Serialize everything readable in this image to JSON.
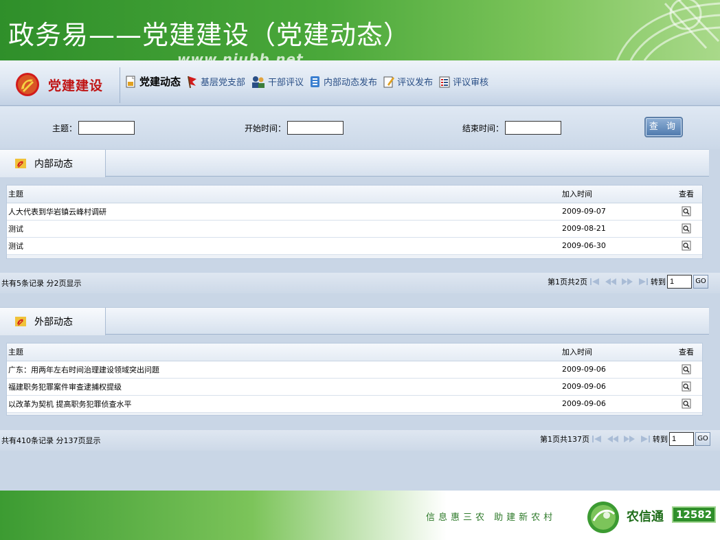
{
  "slide": {
    "title": "政务易——党建建设（党建动态）",
    "watermark": "www.niubb.net"
  },
  "brand": {
    "label": "党建建设",
    "icon": "party-emblem-icon"
  },
  "nav": [
    {
      "label": "党建动态",
      "icon": "document-icon",
      "active": true
    },
    {
      "label": "基层党支部",
      "icon": "flag-icon",
      "active": false
    },
    {
      "label": "干部评议",
      "icon": "people-icon",
      "active": false
    },
    {
      "label": "内部动态发布",
      "icon": "publish-icon",
      "active": false
    },
    {
      "label": "评议发布",
      "icon": "edit-icon",
      "active": false
    },
    {
      "label": "评议审核",
      "icon": "review-icon",
      "active": false
    }
  ],
  "search": {
    "subject_label": "主题：",
    "start_label": "开始时间：",
    "end_label": "结束时间：",
    "query_button": "查 询"
  },
  "sections": {
    "internal": {
      "title": "内部动态",
      "headers": {
        "subject": "主题",
        "date": "加入时间",
        "view": "查看"
      },
      "rows": [
        {
          "subject": "人大代表到华岩镇云峰村调研",
          "date": "2009-09-07"
        },
        {
          "subject": "测试",
          "date": "2009-08-21"
        },
        {
          "subject": "测试",
          "date": "2009-06-30"
        }
      ],
      "summary": "共有5条记录 分2页显示",
      "page_info": "第1页共2页",
      "goto_label": "转到",
      "goto_value": "1",
      "go_button": "GO"
    },
    "external": {
      "title": "外部动态",
      "headers": {
        "subject": "主题",
        "date": "加入时间",
        "view": "查看"
      },
      "rows": [
        {
          "subject": "广东：用两年左右时间治理建设领域突出问题",
          "date": "2009-09-06"
        },
        {
          "subject": "福建职务犯罪案件审查逮捕权提级",
          "date": "2009-09-06"
        },
        {
          "subject": "以改革为契机 提高职务犯罪侦查水平",
          "date": "2009-09-06"
        }
      ],
      "summary": "共有410条记录 分137页显示",
      "page_info": "第1页共137页",
      "goto_label": "转到",
      "goto_value": "1",
      "go_button": "GO"
    }
  },
  "footer": {
    "slogan": "信息惠三农 助建新农村",
    "logo_text": "农信通",
    "logo_number": "12582"
  },
  "colors": {
    "header_green": "#2f8f2a",
    "nav_blue": "#2a4f86",
    "brand_red": "#c01515"
  }
}
